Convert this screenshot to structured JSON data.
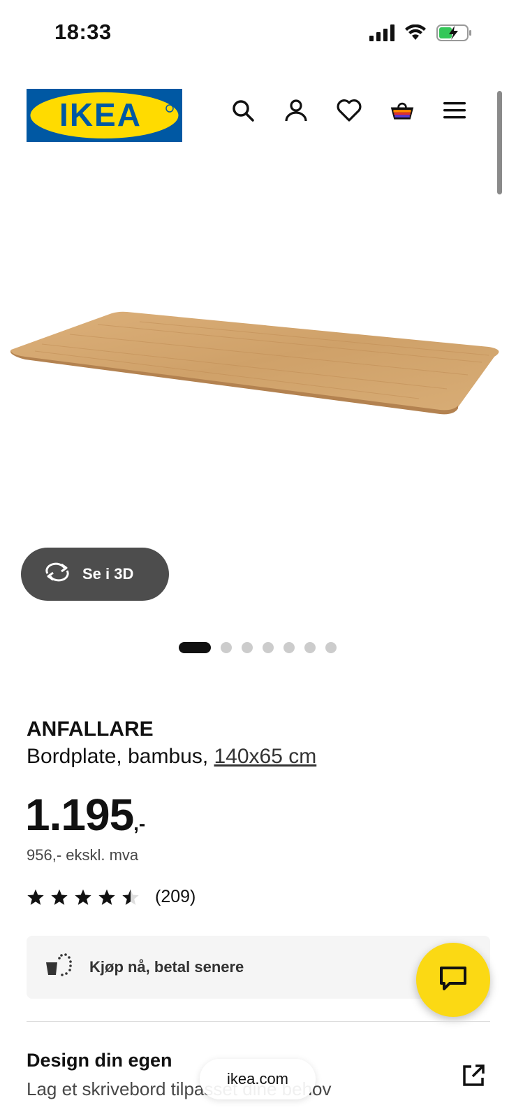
{
  "status_bar": {
    "time": "18:33",
    "icons": [
      "signal-icon",
      "wifi-icon",
      "battery-charging-icon"
    ]
  },
  "header": {
    "logo_text": "IKEA",
    "brand_colors": {
      "blue": "#0058a3",
      "yellow": "#ffdb00"
    },
    "nav_icons": [
      "search-icon",
      "account-icon",
      "heart-icon",
      "basket-icon",
      "menu-icon"
    ]
  },
  "gallery": {
    "view_3d_label": "Se i 3D",
    "dot_count": 7,
    "active_index": 0
  },
  "product": {
    "name": "ANFALLARE",
    "description": "Bordplate, bambus,",
    "size_link": "140x65 cm",
    "price_amount": "1.195",
    "price_suffix": ",-",
    "price_ex_vat": "956,- ekskl. mva",
    "rating_value": 4.5,
    "rating_max": 5,
    "rating_count": "(209)"
  },
  "pay_later": {
    "label": "Kjøp nå, betal senere"
  },
  "chat": {
    "accent": "#fbd914"
  },
  "design": {
    "title": "Design din egen",
    "subtitle": "Lag et skrivebord tilpasset dine behov"
  },
  "browser": {
    "url": "ikea.com"
  }
}
